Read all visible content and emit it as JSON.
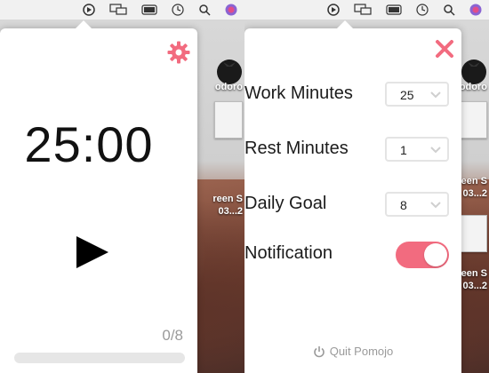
{
  "menubar": {
    "icons": [
      "pomojo-icon",
      "display-mirror-icon",
      "battery-icon",
      "clock-icon",
      "search-icon",
      "siri-icon"
    ]
  },
  "desktop": {
    "labels": [
      "odoro",
      "reen S",
      "03...2",
      "reen S",
      "03...2"
    ]
  },
  "timer_view": {
    "time": "25:00",
    "progress_text": "0/8",
    "progress_fraction": 0,
    "accent_color": "#f26b7f",
    "icons": [
      "gear-icon",
      "play-icon"
    ]
  },
  "settings_view": {
    "work": {
      "label": "Work Minutes",
      "value": "25"
    },
    "rest": {
      "label": "Rest Minutes",
      "value": "1"
    },
    "goal": {
      "label": "Daily Goal",
      "value": "8"
    },
    "notification": {
      "label": "Notification",
      "enabled": true
    },
    "quit_label": "Quit Pomojo",
    "icons": [
      "close-icon",
      "power-icon",
      "chevron-down-icon"
    ]
  }
}
